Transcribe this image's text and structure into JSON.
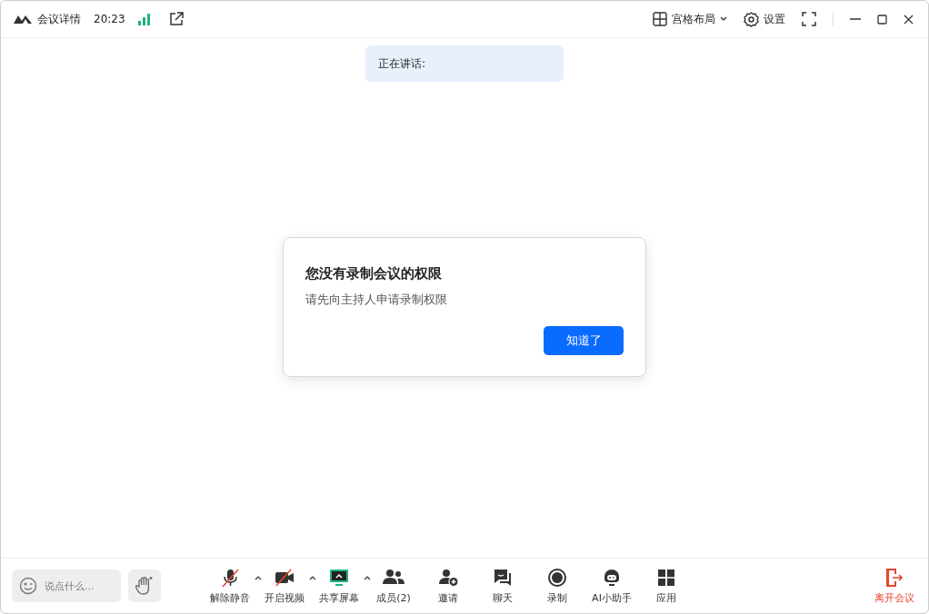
{
  "title_bar": {
    "meeting_details": "会议详情",
    "time": "20:23",
    "layout": "宫格布局",
    "settings": "设置"
  },
  "speaking_banner": {
    "label": "正在讲话:"
  },
  "dialog": {
    "title": "您没有录制会议的权限",
    "message": "请先向主持人申请录制权限",
    "button": "知道了"
  },
  "chat_input": {
    "placeholder": "说点什么..."
  },
  "toolbar": [
    {
      "label": "解除静音",
      "muted": true,
      "menu": true
    },
    {
      "label": "开启视频",
      "muted": true,
      "menu": true
    },
    {
      "label": "共享屏幕",
      "menu": true
    },
    {
      "label": "成员(2)",
      "menu": false
    },
    {
      "label": "邀请",
      "menu": false
    },
    {
      "label": "聊天",
      "menu": false
    },
    {
      "label": "录制",
      "menu": false
    },
    {
      "label": "AI小助手",
      "menu": false
    }
  ],
  "apps": {
    "label": "应用"
  },
  "leave": {
    "label": "离开会议"
  }
}
